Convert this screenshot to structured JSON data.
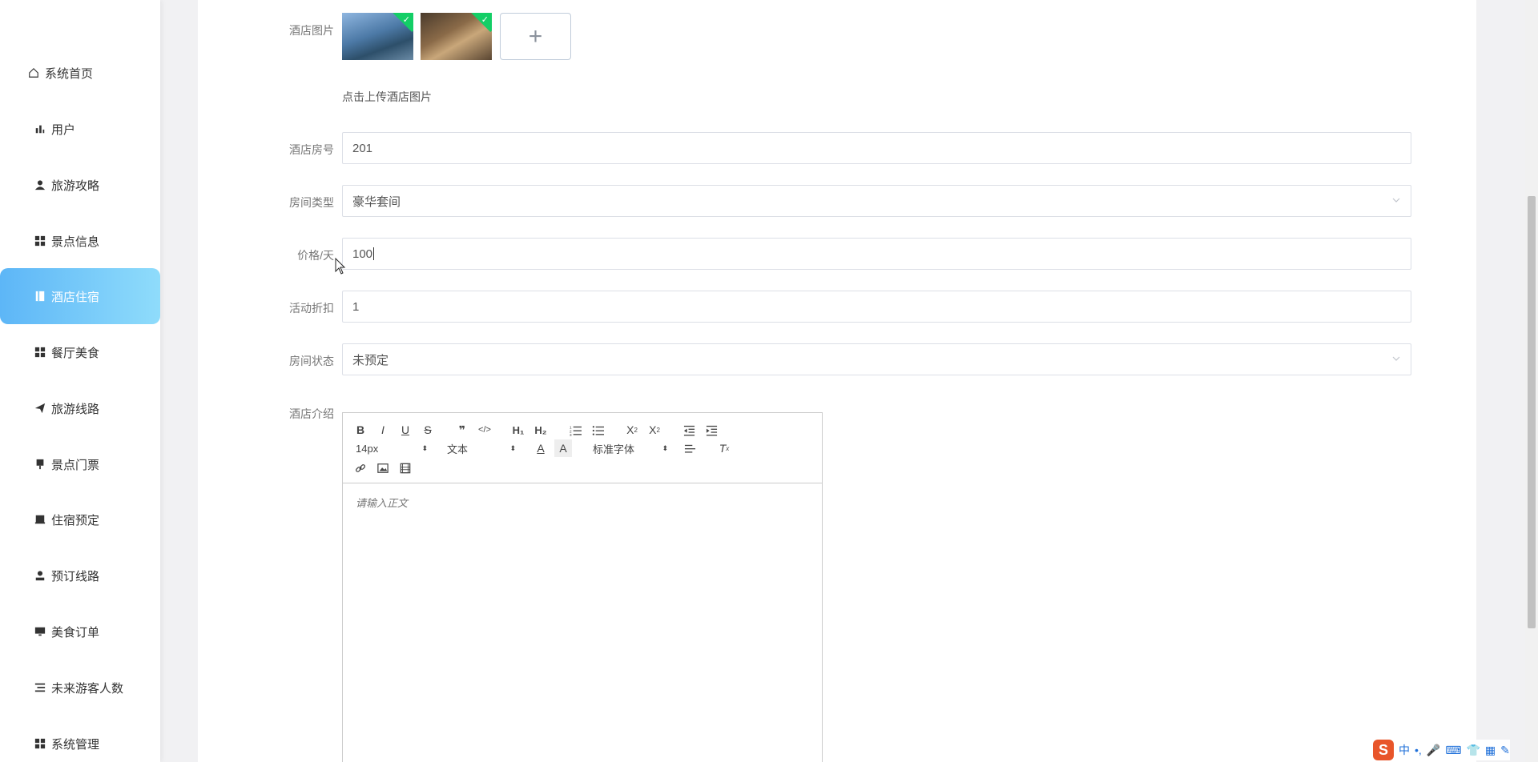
{
  "sidebar": {
    "items": [
      {
        "label": "系统首页",
        "icon": "home-icon"
      },
      {
        "label": "用户",
        "icon": "bar-chart-icon"
      },
      {
        "label": "旅游攻略",
        "icon": "user-icon"
      },
      {
        "label": "景点信息",
        "icon": "grid-icon"
      },
      {
        "label": "酒店住宿",
        "icon": "book-icon"
      },
      {
        "label": "餐厅美食",
        "icon": "grid-icon"
      },
      {
        "label": "旅游线路",
        "icon": "send-icon"
      },
      {
        "label": "景点门票",
        "icon": "ticket-icon"
      },
      {
        "label": "住宿预定",
        "icon": "bed-icon"
      },
      {
        "label": "预订线路",
        "icon": "person-icon"
      },
      {
        "label": "美食订单",
        "icon": "monitor-icon"
      },
      {
        "label": "未来游客人数",
        "icon": "list-icon"
      },
      {
        "label": "系统管理",
        "icon": "grid-icon"
      }
    ],
    "active": "酒店住宿"
  },
  "form": {
    "images_label": "酒店图片",
    "upload_hint": "点击上传酒店图片",
    "room_no_label": "酒店房号",
    "room_no_value": "201",
    "room_type_label": "房间类型",
    "room_type_value": "豪华套间",
    "price_label": "价格/天",
    "price_value": "100",
    "discount_label": "活动折扣",
    "discount_value": "1",
    "status_label": "房间状态",
    "status_value": "未预定",
    "intro_label": "酒店介绍"
  },
  "editor": {
    "font_size": "14px",
    "header_picker": "文本",
    "font_family": "标准字体",
    "placeholder": "请输入正文"
  },
  "ime": {
    "lang": "中",
    "punct": "•,"
  },
  "colors": {
    "active_start": "#5db6f7",
    "active_end": "#8fdcfb",
    "upload_success": "#13ce66"
  }
}
